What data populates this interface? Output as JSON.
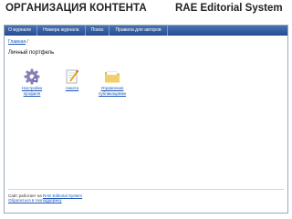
{
  "header": {
    "left_title": "ОРГАНИЗАЦИЯ КОНТЕНТА",
    "right_title": "RAE Editorial System"
  },
  "nav": {
    "items": [
      "О журнале",
      "Номера журнала",
      "Поиск",
      "Правила для авторов"
    ]
  },
  "breadcrumb": {
    "home": "Главная",
    "separator": "/"
  },
  "page": {
    "title": "Личный портфель"
  },
  "tiles": [
    {
      "label_line1": "Настройки",
      "label_line2": "профиля",
      "icon": "gear-icon"
    },
    {
      "label_line1": "Анкета",
      "label_line2": "",
      "icon": "document-pen-icon"
    },
    {
      "label_line1": "Управление",
      "label_line2": "публикациями",
      "icon": "folder-icon"
    }
  ],
  "footer": {
    "line1_prefix": "Сайт работает на ",
    "line1_link": "RAE Editorial System",
    "line2": "Обратиться в техподдержку"
  },
  "colors": {
    "nav_bg": "#2f5a9e",
    "link": "#1b56b8"
  }
}
